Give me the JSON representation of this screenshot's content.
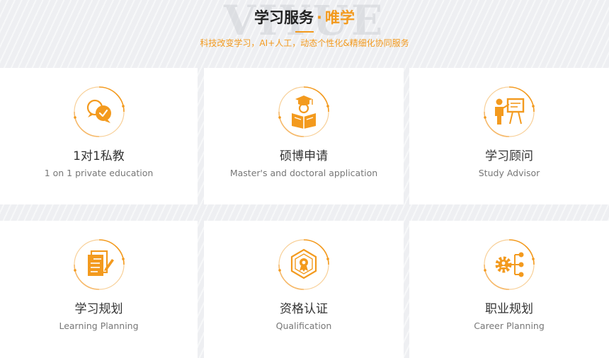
{
  "header": {
    "watermark": "VIYUE",
    "title_main": "学习服务",
    "title_dot": "·",
    "title_accent": "唯学",
    "subtitle": "科技改变学习，AI+人工，动态个性化&精细化协同服务"
  },
  "colors": {
    "accent": "#f39a1e",
    "background": "#eeeff2",
    "card": "#ffffff",
    "title_text": "#333333",
    "sub_text": "#777777"
  },
  "services": [
    {
      "title": "1对1私教",
      "subtitle": "1 on 1 private education",
      "icon": "chat-bubbles-icon"
    },
    {
      "title": "硕博申请",
      "subtitle": "Master's and doctoral application",
      "icon": "graduate-reading-icon"
    },
    {
      "title": "学习顾问",
      "subtitle": "Study Advisor",
      "icon": "teacher-board-icon"
    },
    {
      "title": "学习规划",
      "subtitle": "Learning Planning",
      "icon": "document-edit-icon"
    },
    {
      "title": "资格认证",
      "subtitle": "Qualification",
      "icon": "certificate-badge-icon"
    },
    {
      "title": "职业规划",
      "subtitle": "Career Planning",
      "icon": "gear-network-icon"
    }
  ]
}
